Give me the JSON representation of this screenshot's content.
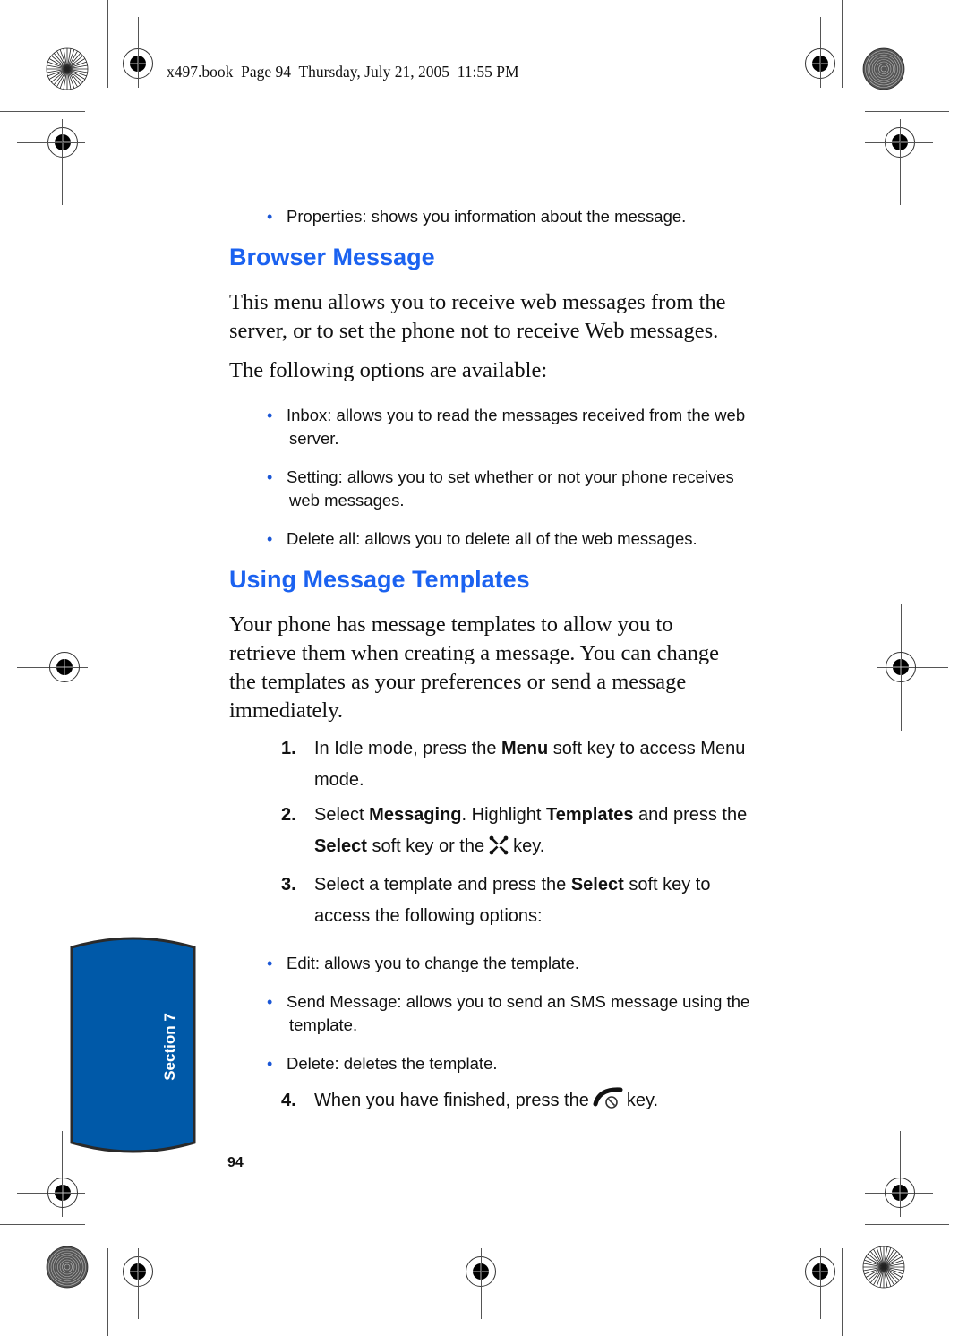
{
  "header": {
    "slug": "x497.book  Page 94  Thursday, July 21, 2005  11:55 PM"
  },
  "top_bullets": [
    {
      "text": "Properties: shows you information about the message."
    }
  ],
  "browser_message": {
    "heading": "Browser Message",
    "intro_line1": "This menu allows you to receive web messages from the",
    "intro_line2": "server, or to set the phone not to receive Web messages.",
    "options_intro": "The following options are available:",
    "bullets": [
      {
        "line1": "Inbox: allows you to read the messages received from the web",
        "line2": "server."
      },
      {
        "line1": "Setting: allows you to set whether or not your phone receives",
        "line2": "web messages."
      },
      {
        "line1": "Delete all: allows you to delete all of the web messages.",
        "line2": ""
      }
    ]
  },
  "templates": {
    "heading": "Using Message Templates",
    "intro_lines": [
      "Your phone has message templates to allow you to",
      "retrieve them when creating a message. You can change",
      "the templates as your preferences or send a message",
      "immediately."
    ],
    "steps": [
      {
        "num": "1.",
        "parts": {
          "a": "In Idle mode, press the ",
          "b": "Menu",
          "c": " soft key to access Menu",
          "d": "mode."
        }
      },
      {
        "num": "2.",
        "parts": {
          "a": "Select ",
          "b": "Messaging",
          "c": ". Highlight ",
          "d": "Templates",
          "e": " and press the",
          "f": "Select",
          "g": " soft key or the",
          "h": "key.",
          "icon": "navigation-select-key-icon"
        }
      },
      {
        "num": "3.",
        "parts": {
          "a": "Select a template and press the ",
          "b": "Select",
          "c": " soft key to",
          "d": "access the following options:"
        }
      },
      {
        "num": "4.",
        "parts": {
          "a": "When you have finished, press the",
          "b": "key.",
          "icon": "end-power-key-icon"
        }
      }
    ],
    "option_bullets": [
      {
        "line1": "Edit: allows you to change the template.",
        "line2": ""
      },
      {
        "line1": "Send Message: allows you to send an SMS message using the",
        "line2": "template."
      },
      {
        "line1": "Delete: deletes the template.",
        "line2": ""
      }
    ]
  },
  "sidebar": {
    "section_label": "Section 7"
  },
  "footer": {
    "page_number": "94"
  },
  "colors": {
    "heading_blue": "#1b62f0",
    "bullet_blue": "#1a56d6",
    "section_tab_blue": "#0059a8",
    "section_tab_border": "#2a2a2a"
  }
}
